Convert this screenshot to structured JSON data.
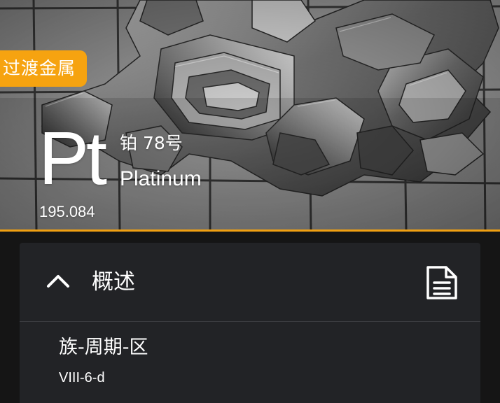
{
  "element": {
    "category": "过渡金属",
    "symbol": "Pt",
    "name_cn_number": "铂 78号",
    "name_en": "Platinum",
    "atomic_mass": "195.084"
  },
  "overview_card": {
    "title": "概述",
    "properties": [
      {
        "label": "族-周期-区",
        "value": "VIII-6-d"
      }
    ]
  },
  "colors": {
    "accent": "#f6a310",
    "background": "#151515",
    "card": "#222326"
  },
  "icons": {
    "collapse": "chevron-up-icon",
    "details": "document-icon"
  }
}
